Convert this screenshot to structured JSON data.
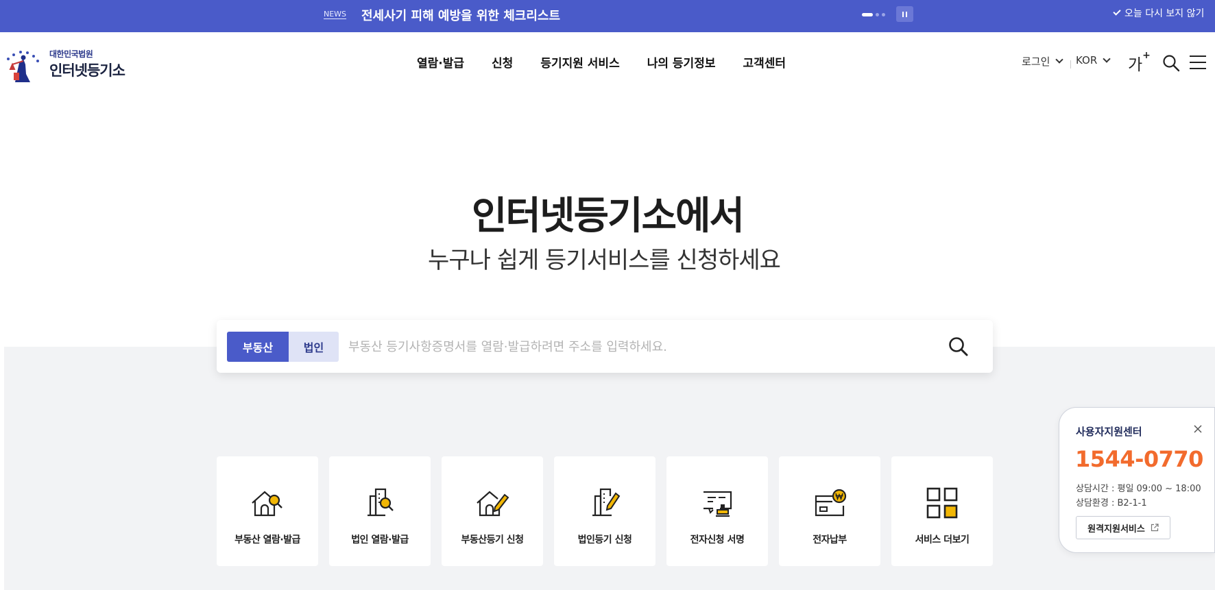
{
  "newsbar": {
    "tag": "NEWS",
    "headline": "전세사기 피해 예방을 위한 체크리스트",
    "dismiss_label": "오늘 다시 보지 않기",
    "dot_count": 3,
    "active_dot": 0
  },
  "header": {
    "logo_small": "대한민국법원",
    "logo_big": "인터넷등기소",
    "nav": [
      "열람·발급",
      "신청",
      "등기지원 서비스",
      "나의 등기정보",
      "고객센터"
    ],
    "login_label": "로그인",
    "language_label": "KOR",
    "font_size_label": "가",
    "font_size_plus": "+"
  },
  "hero": {
    "title": "인터넷등기소에서",
    "subtitle": "누구나 쉽게 등기서비스를 신청하세요"
  },
  "search": {
    "tabs": [
      "부동산",
      "법인"
    ],
    "active_tab": 0,
    "placeholder": "부동산 등기사항증명서를 열람·발급하려면 주소를 입력하세요."
  },
  "services": [
    {
      "label": "부동산 열람·발급",
      "icon": "house-search-icon"
    },
    {
      "label": "법인 열람·발급",
      "icon": "building-search-icon"
    },
    {
      "label": "부동산등기 신청",
      "icon": "house-pencil-icon"
    },
    {
      "label": "법인등기 신청",
      "icon": "building-pencil-icon"
    },
    {
      "label": "전자신청 서명",
      "icon": "e-sign-stamp-icon"
    },
    {
      "label": "전자납부",
      "icon": "won-payment-icon"
    },
    {
      "label": "서비스 더보기",
      "icon": "grid-more-icon"
    }
  ],
  "support": {
    "title": "사용자지원센터",
    "phone": "1544-0770",
    "hours": "상담시간 : 평일 09:00 ~ 18:00",
    "env": "상담환경 : B2-1-1",
    "remote_label": "원격지원서비스"
  },
  "colors": {
    "brand": "#4a5bc9",
    "accent": "#f2b705",
    "phone": "#f26b2d",
    "band": "#f2f3f5"
  }
}
